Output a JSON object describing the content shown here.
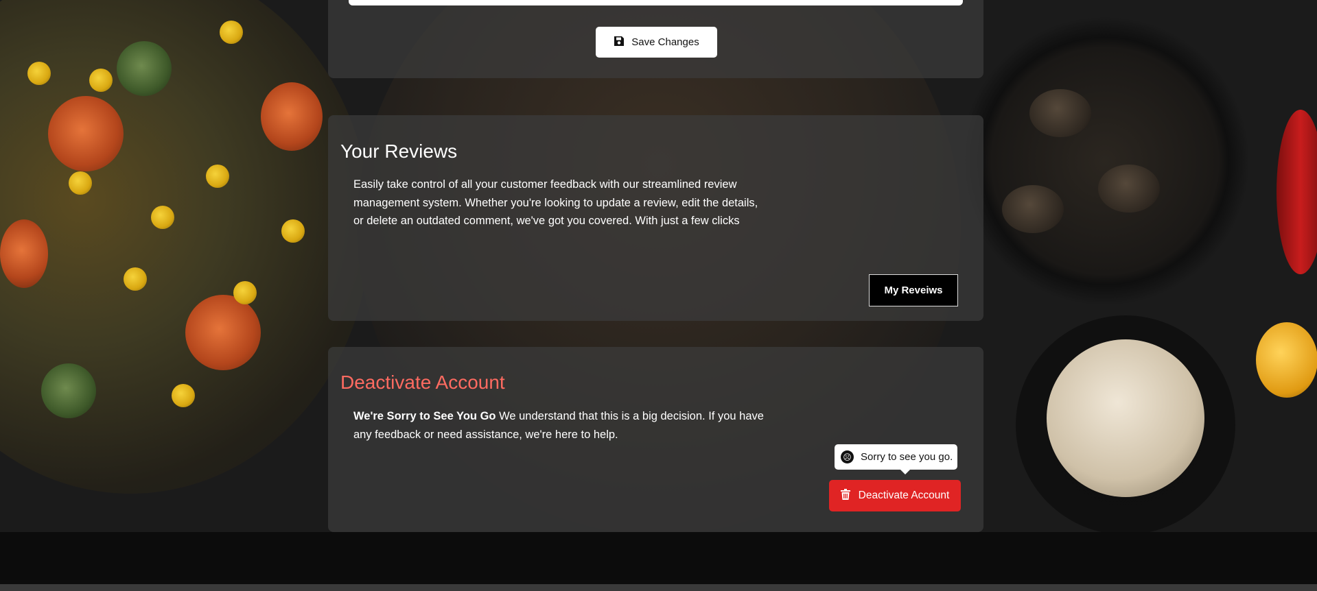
{
  "profile": {
    "save_label": "Save Changes"
  },
  "reviews": {
    "title": "Your Reviews",
    "description": "Easily take control of all your customer feedback with our streamlined review management system. Whether you're looking to update a review, edit the details, or delete an outdated comment, we've got you covered. With just a few clicks",
    "button_label": "My Reveiws"
  },
  "deactivate": {
    "title": "Deactivate Account",
    "lead": "We're Sorry to See You Go",
    "message": "We understand that this is a big decision. If you have any feedback or need assistance, we're here to help.",
    "tooltip": "Sorry to see you go.",
    "button_label": "Deactivate Account",
    "title_color": "#ff6b61",
    "button_color": "#e02424"
  },
  "icons": {
    "save": "floppy-disk-icon",
    "tooltip": "sad-face-icon",
    "deactivate": "trash-icon"
  }
}
